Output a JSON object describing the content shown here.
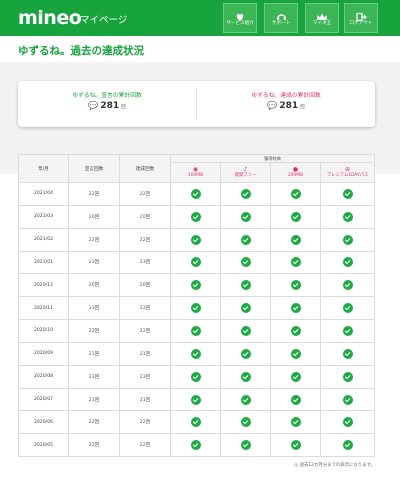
{
  "header": {
    "logo": "mineo",
    "page_name": "マイページ",
    "nav": [
      {
        "label": "サービス紹介",
        "icon": "heart-leaf-icon"
      },
      {
        "label": "サポート",
        "icon": "support-icon"
      },
      {
        "label": "マイネ王",
        "icon": "crown-icon"
      },
      {
        "label": "ログアウト",
        "icon": "logout-icon"
      }
    ]
  },
  "title": "ゆずるね。過去の達成状況",
  "summary": {
    "left": {
      "label": "ゆずるね。宣言の累計回数",
      "value": "281",
      "unit": "回",
      "color": "#17a43d"
    },
    "right": {
      "label": "ゆずるね。達成の累計回数",
      "value": "281",
      "unit": "回",
      "color": "#e3326c"
    }
  },
  "table": {
    "col_month": "年/月",
    "col_declared": "宣言回数",
    "col_achieved": "達成回数",
    "bonus_header": "獲得特典",
    "bonuses": [
      {
        "icon": "◉",
        "name": "100MB"
      },
      {
        "icon": "♪",
        "name": "夜間フリー"
      },
      {
        "icon": "●",
        "name": "200MB"
      },
      {
        "icon": "⊕",
        "name": "プレミアム1DAYパス"
      }
    ],
    "rows": [
      {
        "month": "2021/04",
        "declared": "22回",
        "achieved": "22回"
      },
      {
        "month": "2021/03",
        "declared": "20回",
        "achieved": "20回"
      },
      {
        "month": "2021/02",
        "declared": "22回",
        "achieved": "22回"
      },
      {
        "month": "2021/01",
        "declared": "23回",
        "achieved": "23回"
      },
      {
        "month": "2020/12",
        "declared": "20回",
        "achieved": "20回"
      },
      {
        "month": "2020/11",
        "declared": "23回",
        "achieved": "23回"
      },
      {
        "month": "2020/10",
        "declared": "22回",
        "achieved": "22回"
      },
      {
        "month": "2020/09",
        "declared": "21回",
        "achieved": "21回"
      },
      {
        "month": "2020/08",
        "declared": "23回",
        "achieved": "23回"
      },
      {
        "month": "2020/07",
        "declared": "21回",
        "achieved": "21回"
      },
      {
        "month": "2020/06",
        "declared": "22回",
        "achieved": "22回"
      },
      {
        "month": "2020/05",
        "declared": "22回",
        "achieved": "22回"
      }
    ]
  },
  "footnote": "◎ 過去12カ月分までの表示になります。"
}
